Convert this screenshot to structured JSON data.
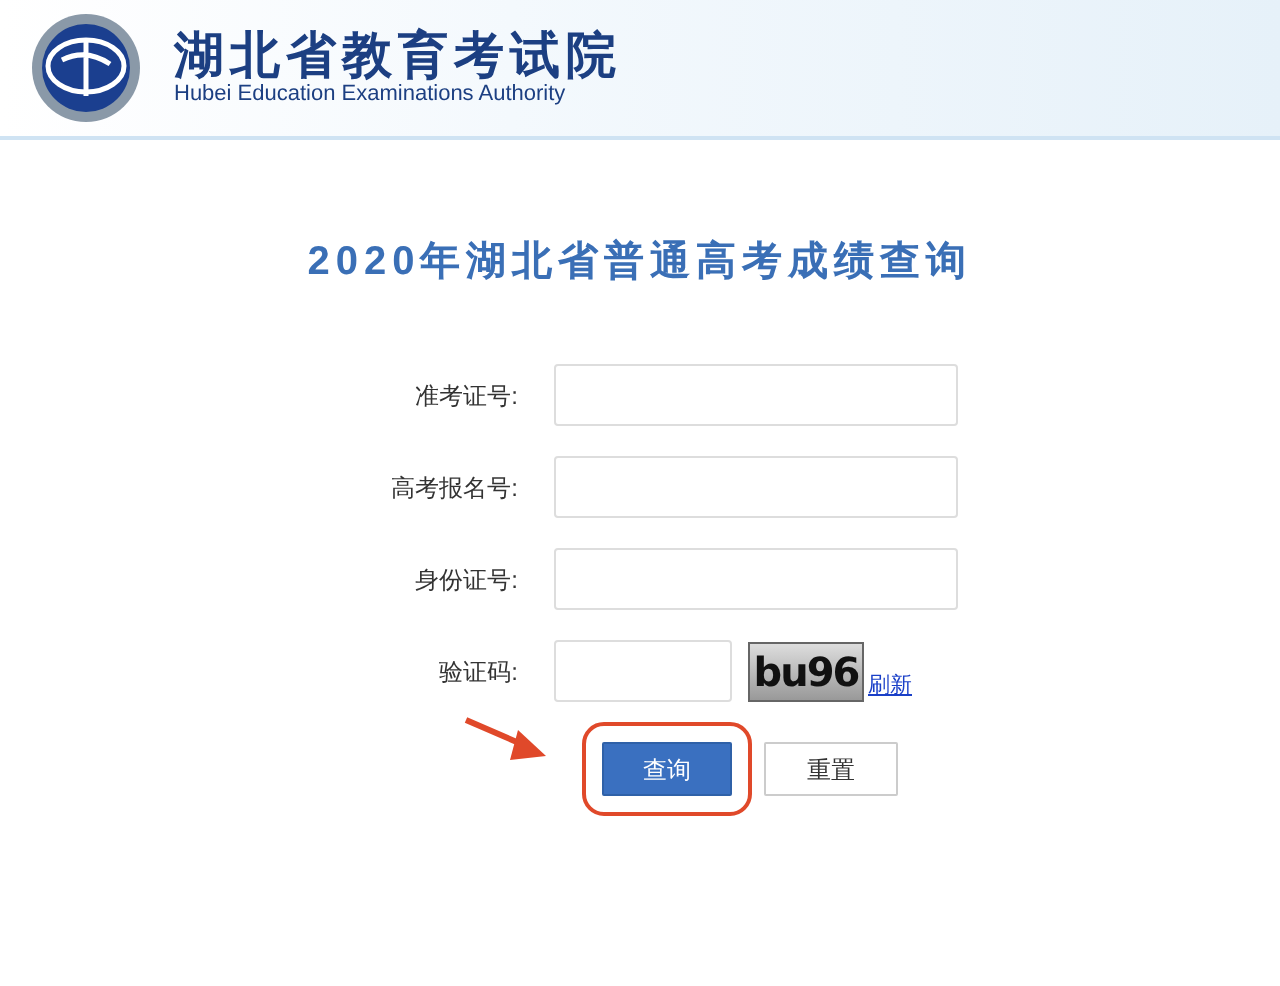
{
  "header": {
    "org_name": "湖北省教育考试院",
    "org_name_en": "Hubei Education Examinations Authority"
  },
  "title": "2020年湖北省普通高考成绩查询",
  "fields": [
    {
      "label": "准考证号:",
      "kind": "text"
    },
    {
      "label": "高考报名号:",
      "kind": "text"
    },
    {
      "label": "身份证号:",
      "kind": "text"
    },
    {
      "label": "验证码:",
      "kind": "captcha",
      "captcha": "bu96",
      "refresh": "刷新"
    }
  ],
  "buttons": [
    {
      "label": "查询",
      "kind": "primary",
      "highlighted": true
    },
    {
      "label": "重置",
      "kind": "secondary",
      "highlighted": false
    }
  ]
}
